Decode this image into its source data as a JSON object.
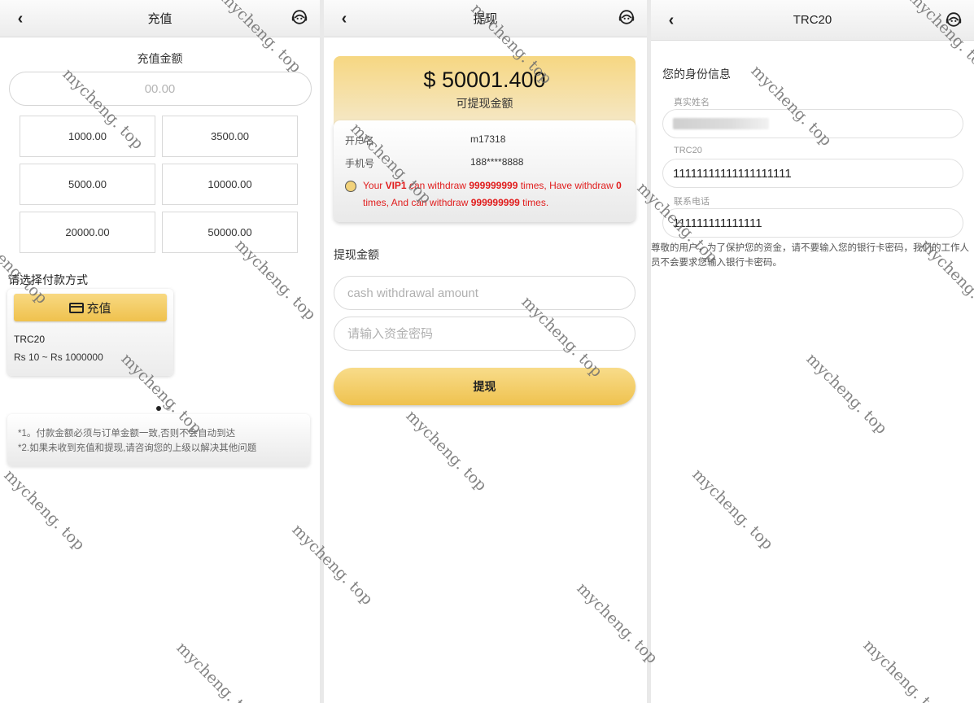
{
  "recharge": {
    "title": "充值",
    "amount_label": "充值金额",
    "amount_placeholder": "00.00",
    "presets": [
      "1000.00",
      "3500.00",
      "5000.00",
      "10000.00",
      "20000.00",
      "50000.00"
    ],
    "pay_method_label": "请选择付款方式",
    "pay_button_label": "充值",
    "channel_name": "TRC20",
    "channel_range": "Rs 10 ~ Rs 1000000",
    "notes": [
      "*1。付款金额必须与订单金额一致,否则不会自动到达",
      "*2.如果未收到充值和提现,请咨询您的上级以解决其他问题"
    ]
  },
  "withdraw": {
    "title": "提现",
    "balance": "$ 50001.400",
    "balance_label": "可提现金额",
    "account_label": "开户名",
    "account_value": "m17318",
    "phone_label": "手机号",
    "phone_value": "188****8888",
    "vip_msg": {
      "p1": "Your ",
      "vip": "VIP1",
      "p2": " can withdraw ",
      "limit": "999999999",
      "p3": " times, Have withdraw ",
      "done": "0",
      "p4": " times, And can withdraw ",
      "remain": "999999999",
      "p5": " times."
    },
    "amount_label": "提现金额",
    "amount_placeholder": "cash withdrawal amount",
    "password_placeholder": "请输入资金密码",
    "submit_label": "提现"
  },
  "trc20": {
    "title": "TRC20",
    "section_title": "您的身份信息",
    "name_label": "真实姓名",
    "address_label": "TRC20",
    "address_value": "11111111111111111111",
    "phone_label": "联系电话",
    "phone_value": "111111111111111",
    "warning": "尊敬的用户，为了保护您的资金，请不要输入您的银行卡密码，我们的工作人员不会要求您输入银行卡密码。"
  },
  "watermark": "mycheng. top",
  "icons": {
    "back": "back-arrow-icon",
    "support": "customer-service-icon",
    "card": "credit-card-icon"
  },
  "colors": {
    "accent_gold": "#efc14d",
    "warning_red": "#e11d1d"
  }
}
